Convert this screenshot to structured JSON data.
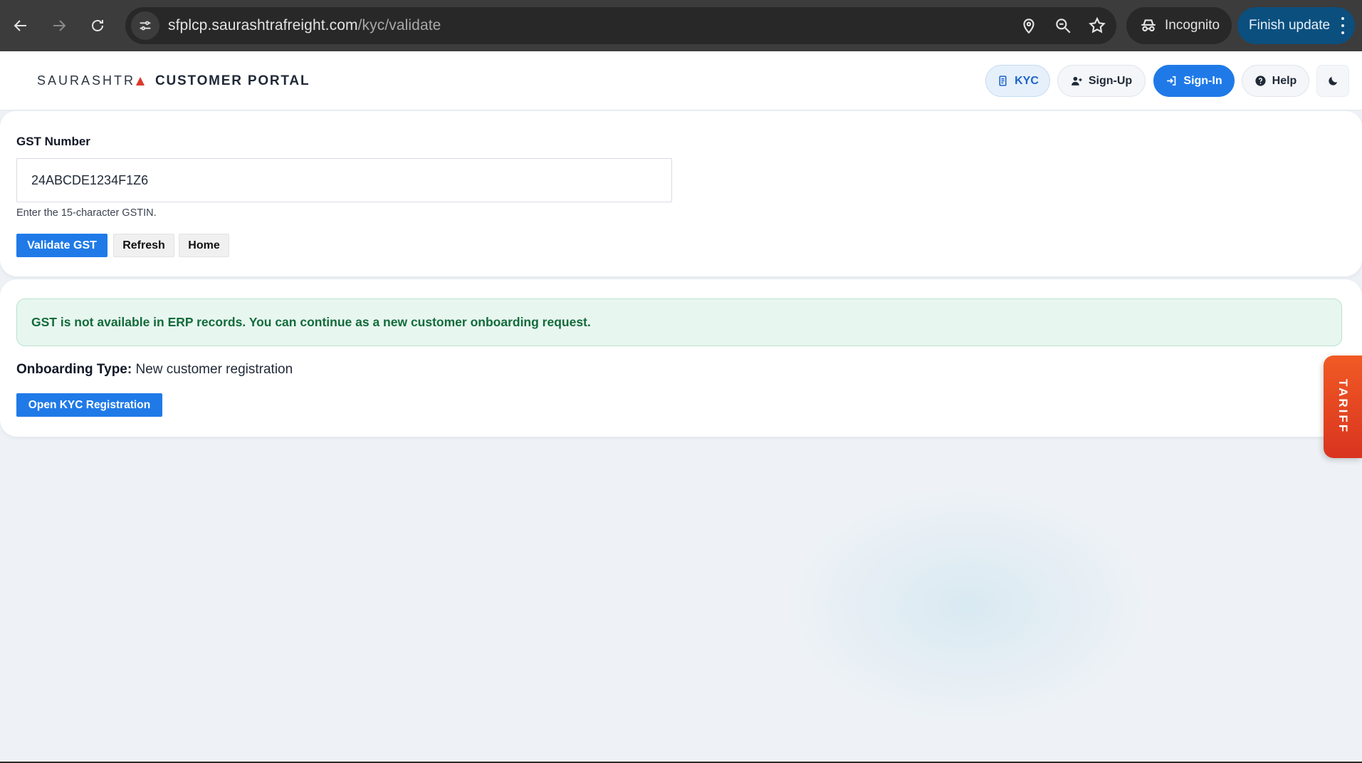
{
  "browser": {
    "url_host": "sfplcp.saurashtrafreight.com",
    "url_path": "/kyc/validate",
    "incognito_label": "Incognito",
    "finish_update_label": "Finish update"
  },
  "header": {
    "brand": "SAURASHTR",
    "title": "CUSTOMER PORTAL",
    "buttons": {
      "kyc": "KYC",
      "signup": "Sign-Up",
      "signin": "Sign-In",
      "help": "Help"
    }
  },
  "gst_form": {
    "label": "GST Number",
    "value": "24ABCDE1234F1Z6",
    "help_text": "Enter the 15-character GSTIN.",
    "validate_label": "Validate GST",
    "refresh_label": "Refresh",
    "home_label": "Home"
  },
  "result": {
    "message": "GST is not available in ERP records. You can continue as a new customer onboarding request.",
    "onboarding_label": "Onboarding Type:",
    "onboarding_value": "New customer registration",
    "open_kyc_label": "Open KYC Registration"
  },
  "tariff_tab": "TARIFF",
  "colors": {
    "primary": "#1f7ae8",
    "success_text": "#126b3a",
    "success_bg": "#e8f6f0",
    "tariff": "#e8421f"
  }
}
